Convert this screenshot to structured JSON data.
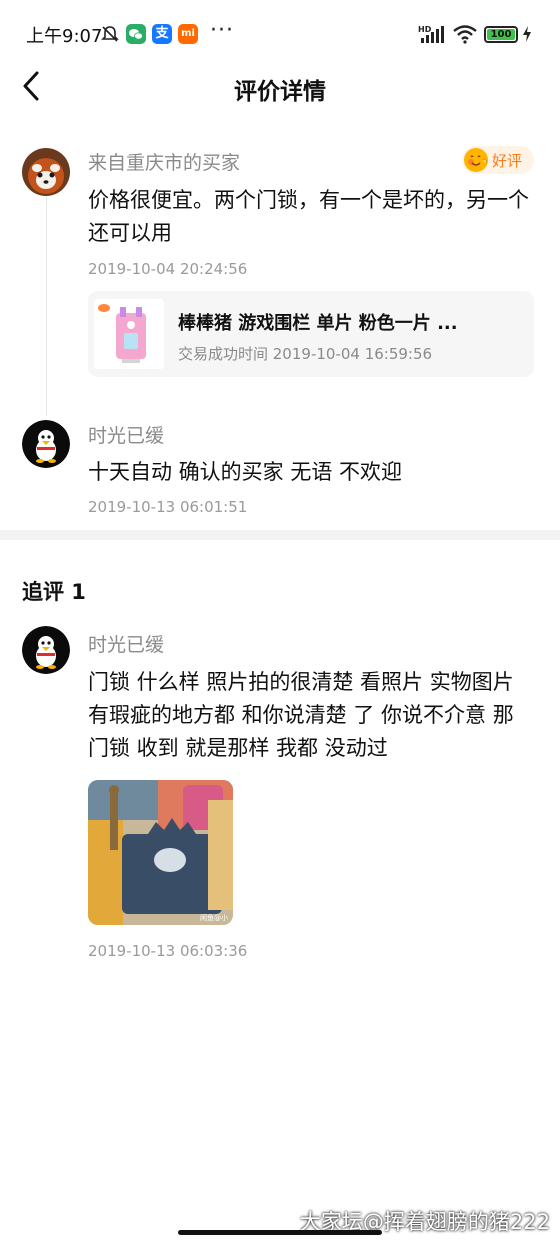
{
  "status_bar": {
    "time": "上午9:07",
    "alipay_glyph": "支",
    "mi_glyph": "mi",
    "more": "···",
    "battery": "100",
    "icons": [
      "bell-muted-icon",
      "wechat-icon",
      "alipay-icon",
      "mi-icon",
      "hd-signal-icon",
      "wifi-icon",
      "battery-icon",
      "charging-icon"
    ]
  },
  "header": {
    "title": "评价详情",
    "back_icon": "back-chevron-icon"
  },
  "review": {
    "username": "来自重庆市的买家",
    "badge": "好评",
    "content": "价格很便宜。两个门锁，有一个是坏的，另一个还可以用",
    "timestamp": "2019-10-04 20:24:56",
    "product": {
      "title": "棒棒猪 游戏围栏 单片 粉色一片 ...",
      "trade_time": "交易成功时间 2019-10-04 16:59:56"
    }
  },
  "reply": {
    "username": "时光已缓",
    "content": "十天自动 确认的买家 无语 不欢迎",
    "timestamp": "2019-10-13 06:01:51"
  },
  "followup": {
    "heading": "追评 1",
    "username": "时光已缓",
    "content": "门锁 什么样  照片拍的很清楚  看照片  实物图片 有瑕疵的地方都 和你说清楚 了 你说不介意  那门锁 收到 就是那样  我都 没动过",
    "photo_caption": "闲鱼@小",
    "timestamp": "2019-10-13 06:03:36"
  },
  "watermark": "大家坛@挥着翅膀的猪222",
  "colors": {
    "badge_orange": "#ff7a1a",
    "muted_text": "#8a8a8a",
    "card_bg": "#f6f6f6"
  }
}
